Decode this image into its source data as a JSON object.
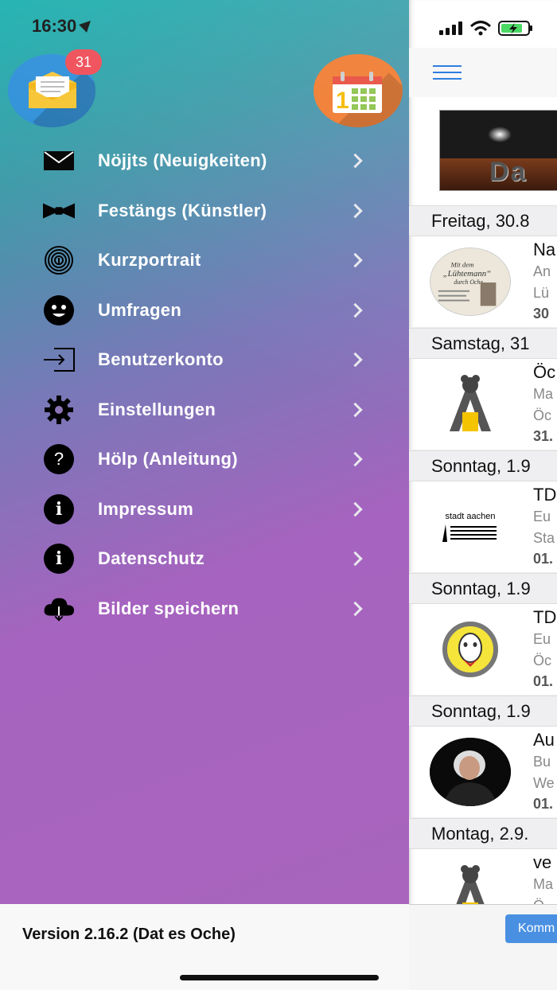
{
  "status_bar": {
    "time": "16:30"
  },
  "drawer": {
    "mail_badge": "31",
    "menu": [
      {
        "label": "Nöjjts (Neuigkeiten)",
        "icon": "envelope-icon"
      },
      {
        "label": "Festängs (Künstler)",
        "icon": "bowtie-icon"
      },
      {
        "label": "Kurzportrait",
        "icon": "fingerprint-icon"
      },
      {
        "label": "Umfragen",
        "icon": "smiley-icon"
      },
      {
        "label": "Benutzerkonto",
        "icon": "login-icon"
      },
      {
        "label": "Einstellungen",
        "icon": "gear-icon"
      },
      {
        "label": "Hölp (Anleitung)",
        "icon": "question-icon"
      },
      {
        "label": "Impressum",
        "icon": "info-icon"
      },
      {
        "label": "Datenschutz",
        "icon": "info-icon"
      },
      {
        "label": "Bilder speichern",
        "icon": "cloud-download-icon"
      }
    ],
    "version": "Version 2.16.2 (Dat es Oche)"
  },
  "feed": {
    "banner_text": "Da",
    "days": [
      {
        "header": "Freitag, 30.8",
        "event": {
          "title": "Na",
          "line1": "An",
          "line2": "Lü",
          "date": "30"
        }
      },
      {
        "header": "Samstag, 31",
        "event": {
          "title": "Öc",
          "line1": "Ma",
          "line2": "Öc",
          "date": "31."
        }
      },
      {
        "header": "Sonntag, 1.9",
        "event": {
          "title": "TD",
          "line1": "Eu",
          "line2": "Sta",
          "date": "01."
        }
      },
      {
        "header": "Sonntag, 1.9",
        "event": {
          "title": "TD",
          "line1": "Eu",
          "line2": "Öc",
          "date": "01."
        }
      },
      {
        "header": "Sonntag, 1.9",
        "event": {
          "title": "Au",
          "line1": "Bu",
          "line2": "We",
          "date": "01."
        }
      },
      {
        "header": "Montag, 2.9.",
        "event": {
          "title": "ve",
          "line1": "Ma",
          "line2": "Ö",
          "date": ""
        }
      }
    ],
    "thumb_captions": {
      "stadt": "stadt aachen"
    },
    "bottom_button": "Komm"
  },
  "colors": {
    "mail_button": "#2d8fd9",
    "calendar_button": "#f07a2e",
    "badge": "#ef4b55",
    "accent": "#2e7ee0"
  }
}
